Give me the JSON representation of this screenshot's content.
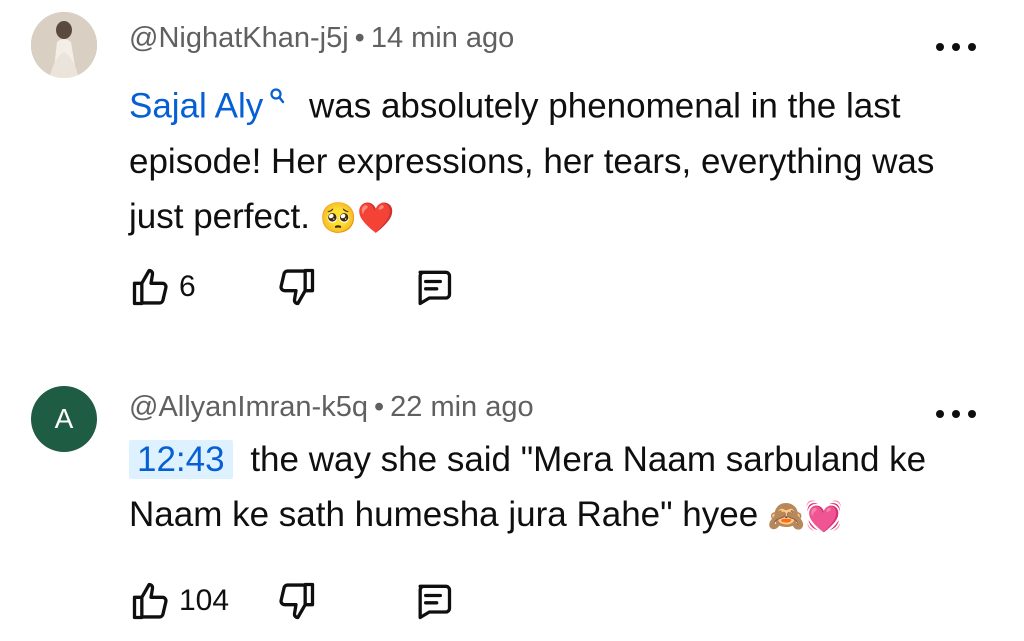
{
  "comments": [
    {
      "author": "@NighatKhan-j5j",
      "separator": "•",
      "time": "14 min ago",
      "avatar_initial": "",
      "mention": "Sajal Aly",
      "text": "was absolutely phenomenal in the last episode! Her expressions, her tears, everything was just perfect.",
      "emojis": [
        "🥺",
        "❤️"
      ],
      "like_count": "6"
    },
    {
      "author": "@AllyanImran-k5q",
      "separator": "•",
      "time": "22 min ago",
      "avatar_initial": "A",
      "avatar_color": "#1e5c43",
      "timestamp_link": "12:43",
      "text": "the way she said \"Mera Naam sarbuland ke Naam ke sath humesha jura Rahe\" hyee",
      "emojis": [
        "🙈",
        "💓"
      ],
      "like_count": "104"
    }
  ],
  "icons": {
    "more": "more-vertical-icon",
    "like": "thumbs-up-icon",
    "dislike": "thumbs-down-icon",
    "reply": "reply-icon",
    "mention": "search-icon"
  },
  "colors": {
    "link": "#065fd4",
    "timestamp_bg": "#def1ff",
    "meta_text": "#606060",
    "avatar_green": "#1e5c43"
  }
}
